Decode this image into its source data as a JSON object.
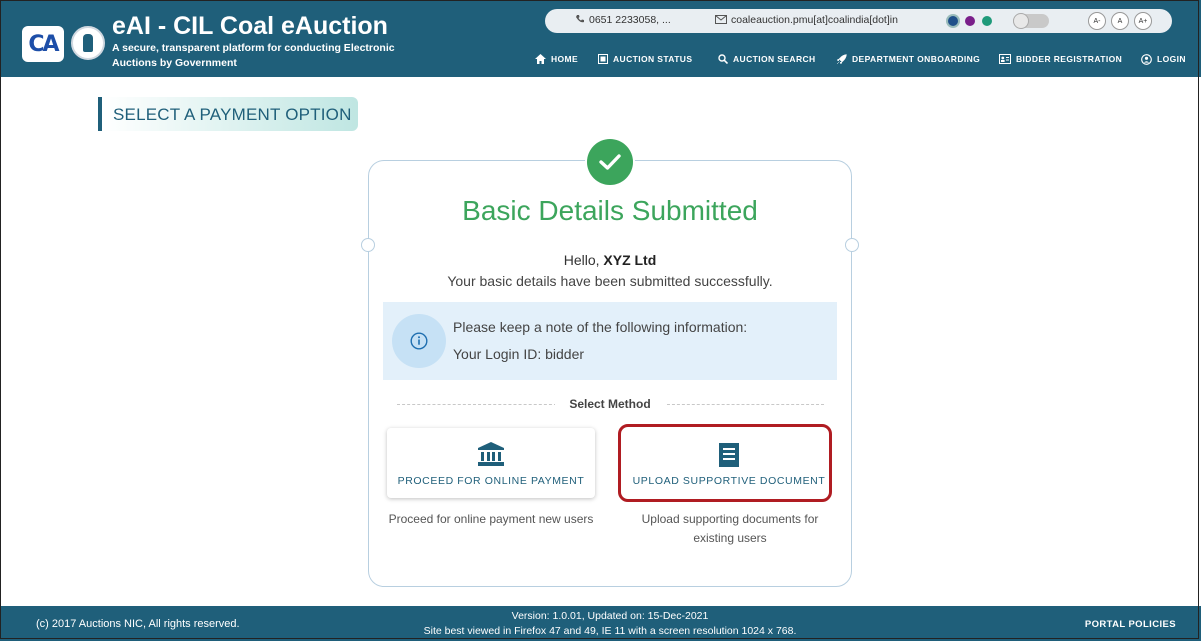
{
  "header": {
    "logo_text": "CA",
    "title": "eAI - CIL Coal eAuction",
    "subtitle": "A secure, transparent platform for conducting Electronic Auctions by Government",
    "contact": {
      "phone": "0651 2233058, ...",
      "email": "coaleauction.pmu[at]coalindia[dot]in"
    },
    "theme_colors": [
      "#1f4f8a",
      "#7a1f8a",
      "#1f9a7a"
    ],
    "font_sizes": [
      "A-",
      "A",
      "A+"
    ],
    "nav": [
      {
        "label": "HOME",
        "icon": "home-icon"
      },
      {
        "label": "AUCTION STATUS",
        "icon": "status-icon"
      },
      {
        "label": "AUCTION SEARCH",
        "icon": "search-icon"
      },
      {
        "label": "DEPARTMENT ONBOARDING",
        "icon": "rocket-icon"
      },
      {
        "label": "BIDDER REGISTRATION",
        "icon": "id-card-icon"
      },
      {
        "label": "LOGIN",
        "icon": "user-circle-icon"
      }
    ]
  },
  "page": {
    "section_title": "SELECT A PAYMENT OPTION",
    "card": {
      "title": "Basic Details Submitted",
      "greeting_prefix": "Hello,",
      "company": "XYZ Ltd",
      "message": "Your basic details have been submitted successfully.",
      "info_note": "Please keep a note of the following information:",
      "login_id_line": "Your Login ID: bidder",
      "divider_label": "Select Method",
      "options": [
        {
          "label": "PROCEED FOR ONLINE PAYMENT",
          "icon": "bank-icon",
          "description": "Proceed for online payment new users"
        },
        {
          "label": "UPLOAD SUPPORTIVE DOCUMENT",
          "icon": "document-icon",
          "description": "Upload supporting documents for existing users"
        }
      ]
    }
  },
  "footer": {
    "copyright": "(c) 2017 Auctions NIC, All rights reserved.",
    "version": "Version: 1.0.01, Updated on: 15-Dec-2021",
    "browser_note": "Site best viewed in Firefox 47 and 49, IE 11 with a screen resolution 1024 x 768.",
    "policies": "PORTAL POLICIES"
  },
  "colors": {
    "header_bg": "#1f5f7a",
    "success_green": "#3ca55c",
    "highlight_red": "#b01c22",
    "info_bg": "#e3f0fa"
  }
}
